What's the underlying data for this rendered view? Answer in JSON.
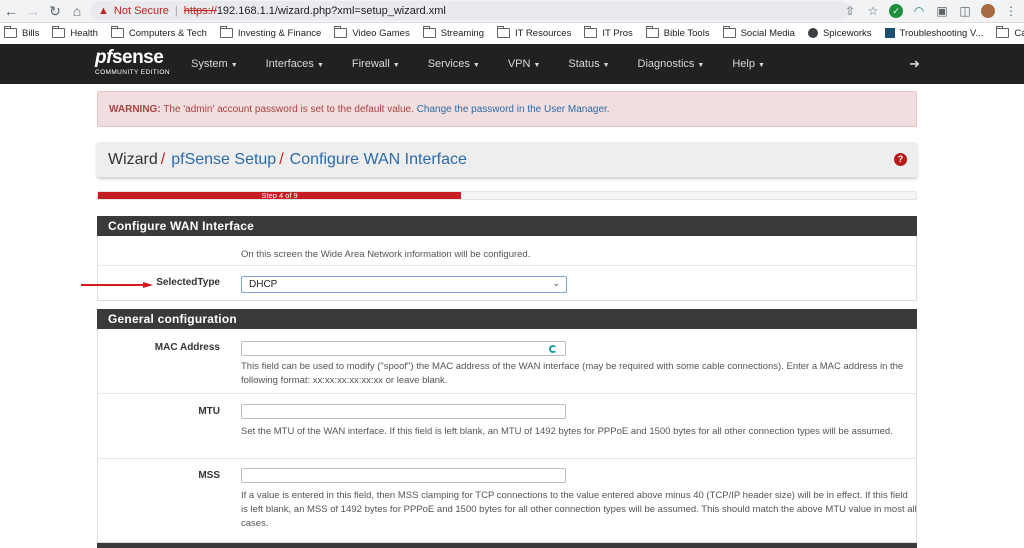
{
  "browser": {
    "security_label": "Not Secure",
    "url_scheme": "https://",
    "url_rest": "192.168.1.1/wizard.php?xml=setup_wizard.xml",
    "bookmarks": [
      "Bills",
      "Health",
      "Computers & Tech",
      "Investing & Finance",
      "Video Games",
      "Streaming",
      "IT Resources",
      "IT Pros",
      "Bible Tools",
      "Social Media",
      "Spiceworks",
      "Troubleshooting V...",
      "Cars"
    ]
  },
  "navbar": {
    "logo_pf": "pf",
    "logo_sense": "sense",
    "logo_sub": "COMMUNITY EDITION",
    "menu": [
      "System",
      "Interfaces",
      "Firewall",
      "Services",
      "VPN",
      "Status",
      "Diagnostics",
      "Help"
    ]
  },
  "alert": {
    "label": "WARNING:",
    "message": " The 'admin' account password is set to the default value. ",
    "link": "Change the password in the User Manager."
  },
  "breadcrumb": {
    "root": "Wizard",
    "level1": "pfSense Setup",
    "level2": "Configure WAN Interface",
    "help": "?"
  },
  "progress": {
    "label": "Step 4 of 9",
    "value": 0.444
  },
  "wan_panel": {
    "title": "Configure WAN Interface",
    "intro": "On this screen the Wide Area Network information will be configured.",
    "selected_type_label": "SelectedType",
    "selected_type_value": "DHCP"
  },
  "general_panel": {
    "title": "General configuration",
    "mac_label": "MAC Address",
    "mac_value": "",
    "mac_help": "This field can be used to modify (\"spoof\") the MAC address of the WAN interface (may be required with some cable connections). Enter a MAC address in the following format: xx:xx:xx:xx:xx:xx or leave blank.",
    "mtu_label": "MTU",
    "mtu_value": "",
    "mtu_help": "Set the MTU of the WAN interface. If this field is left blank, an MTU of 1492 bytes for PPPoE and 1500 bytes for all other connection types will be assumed.",
    "mss_label": "MSS",
    "mss_value": "",
    "mss_help": "If a value is entered in this field, then MSS clamping for TCP connections to the value entered above minus 40 (TCP/IP header size) will be in effect. If this field is left blank, an MSS of 1492 bytes for PPPoE and 1500 bytes for all other connection types will be assumed. This should match the above MTU value in most all cases."
  },
  "colors": {
    "navbar": "#212121",
    "accent_red": "#c71c22",
    "link_blue": "#2b6ba8",
    "alert_bg": "#f2dede"
  },
  "icons": {
    "back": "arrow-left-icon",
    "forward": "arrow-right-icon",
    "reload": "reload-icon",
    "home": "home-icon",
    "warning": "warning-triangle-icon",
    "logout": "logout-icon",
    "help": "question-circle-icon"
  }
}
